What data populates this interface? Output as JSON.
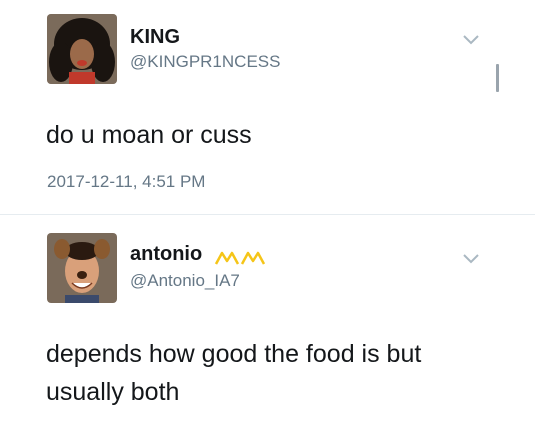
{
  "tweets": [
    {
      "display_name": "KING",
      "handle": "@KINGPR1NCESS",
      "text": "do u moan or cuss",
      "timestamp": "2017-12-11, 4:51 PM",
      "avatar_icon": "avatar-photo-icon"
    },
    {
      "display_name": "antonio",
      "handle": "@Antonio_IA7",
      "text_lines": [
        "depends how good the food is but",
        "usually both"
      ],
      "name_emoji": "crown-emoji-icon",
      "avatar_icon": "avatar-photo-icon"
    }
  ],
  "colors": {
    "name": "#14171a",
    "secondary": "#657786",
    "divider": "#e6ecf0",
    "chevron": "#aab8c2",
    "emoji": "#f5c518"
  },
  "icons": {
    "menu": "chevron-down-icon"
  }
}
